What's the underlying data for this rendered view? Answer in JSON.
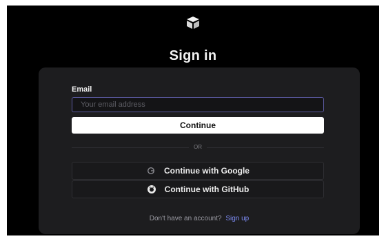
{
  "header": {
    "logo_icon": "cube-logo-icon",
    "title": "Sign in"
  },
  "form": {
    "email_label": "Email",
    "email_placeholder": "Your email address",
    "email_value": "",
    "continue_label": "Continue",
    "divider_text": "OR"
  },
  "social": {
    "google": {
      "label": "Continue with Google",
      "icon": "google-icon"
    },
    "github": {
      "label": "Continue with GitHub",
      "icon": "github-icon"
    }
  },
  "footer": {
    "prompt": "Don't have an account?",
    "signup_label": "Sign up"
  },
  "colors": {
    "background": "#000000",
    "card": "#1d1d1f",
    "input_border": "#5b5aa0",
    "primary_button": "#ffffff",
    "link": "#7d8cf5"
  }
}
